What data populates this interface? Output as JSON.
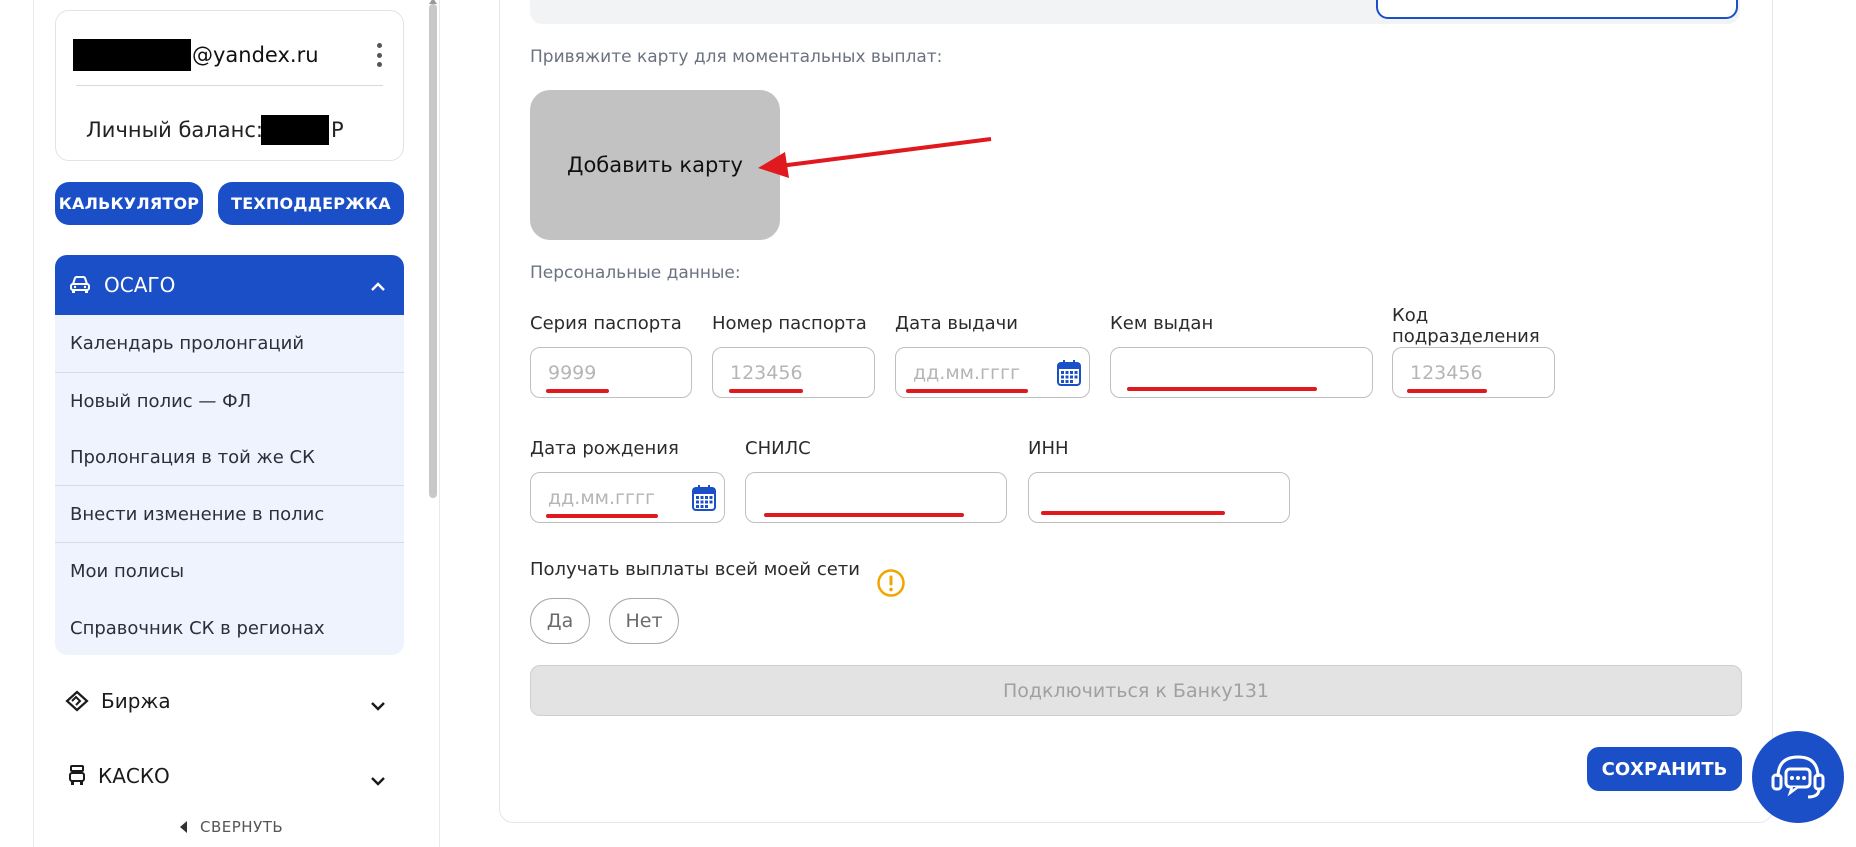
{
  "account": {
    "email_domain": "@yandex.ru",
    "balance_label": "Личный баланс:",
    "currency": "Р"
  },
  "buttons": {
    "calculator": "КАЛЬКУЛЯТОР",
    "support": "ТЕХПОДДЕРЖКА"
  },
  "nav": {
    "osago": {
      "label": "ОСАГО",
      "items": [
        "Календарь пролонгаций",
        "Новый полис — ФЛ",
        "Пролонгация в той же СК",
        "Внести изменение в полис",
        "Мои полисы",
        "Справочник СК в регионах"
      ]
    },
    "birzha": "Биржа",
    "kasko": "КАСКО",
    "collapse": "СВЕРНУТЬ"
  },
  "form": {
    "card_section_label": "Привяжите карту для моментальных выплат:",
    "add_card": "Добавить карту",
    "personal_label": "Персональные данные:",
    "fields": {
      "passport_series": {
        "label": "Серия паспорта",
        "placeholder": "9999"
      },
      "passport_number": {
        "label": "Номер паспорта",
        "placeholder": "123456"
      },
      "issue_date": {
        "label": "Дата выдачи",
        "placeholder": "дд.мм.гггг"
      },
      "issued_by": {
        "label": "Кем выдан",
        "placeholder": ""
      },
      "division_code": {
        "label_line1": "Код",
        "label_line2": "подразделения",
        "placeholder": "123456"
      },
      "birth_date": {
        "label": "Дата рождения",
        "placeholder": "дд.мм.гггг"
      },
      "snils": {
        "label": "СНИЛС",
        "placeholder": ""
      },
      "inn": {
        "label": "ИНН",
        "placeholder": ""
      }
    },
    "network_payouts_label": "Получать выплаты всей моей сети",
    "yes": "Да",
    "no": "Нет",
    "connect_bank": "Подключиться к Банку131",
    "save": "СОХРАНИТЬ"
  },
  "colors": {
    "primary": "#1b4fc7",
    "annotation_red": "#e0191e",
    "warning": "#f0a500"
  }
}
